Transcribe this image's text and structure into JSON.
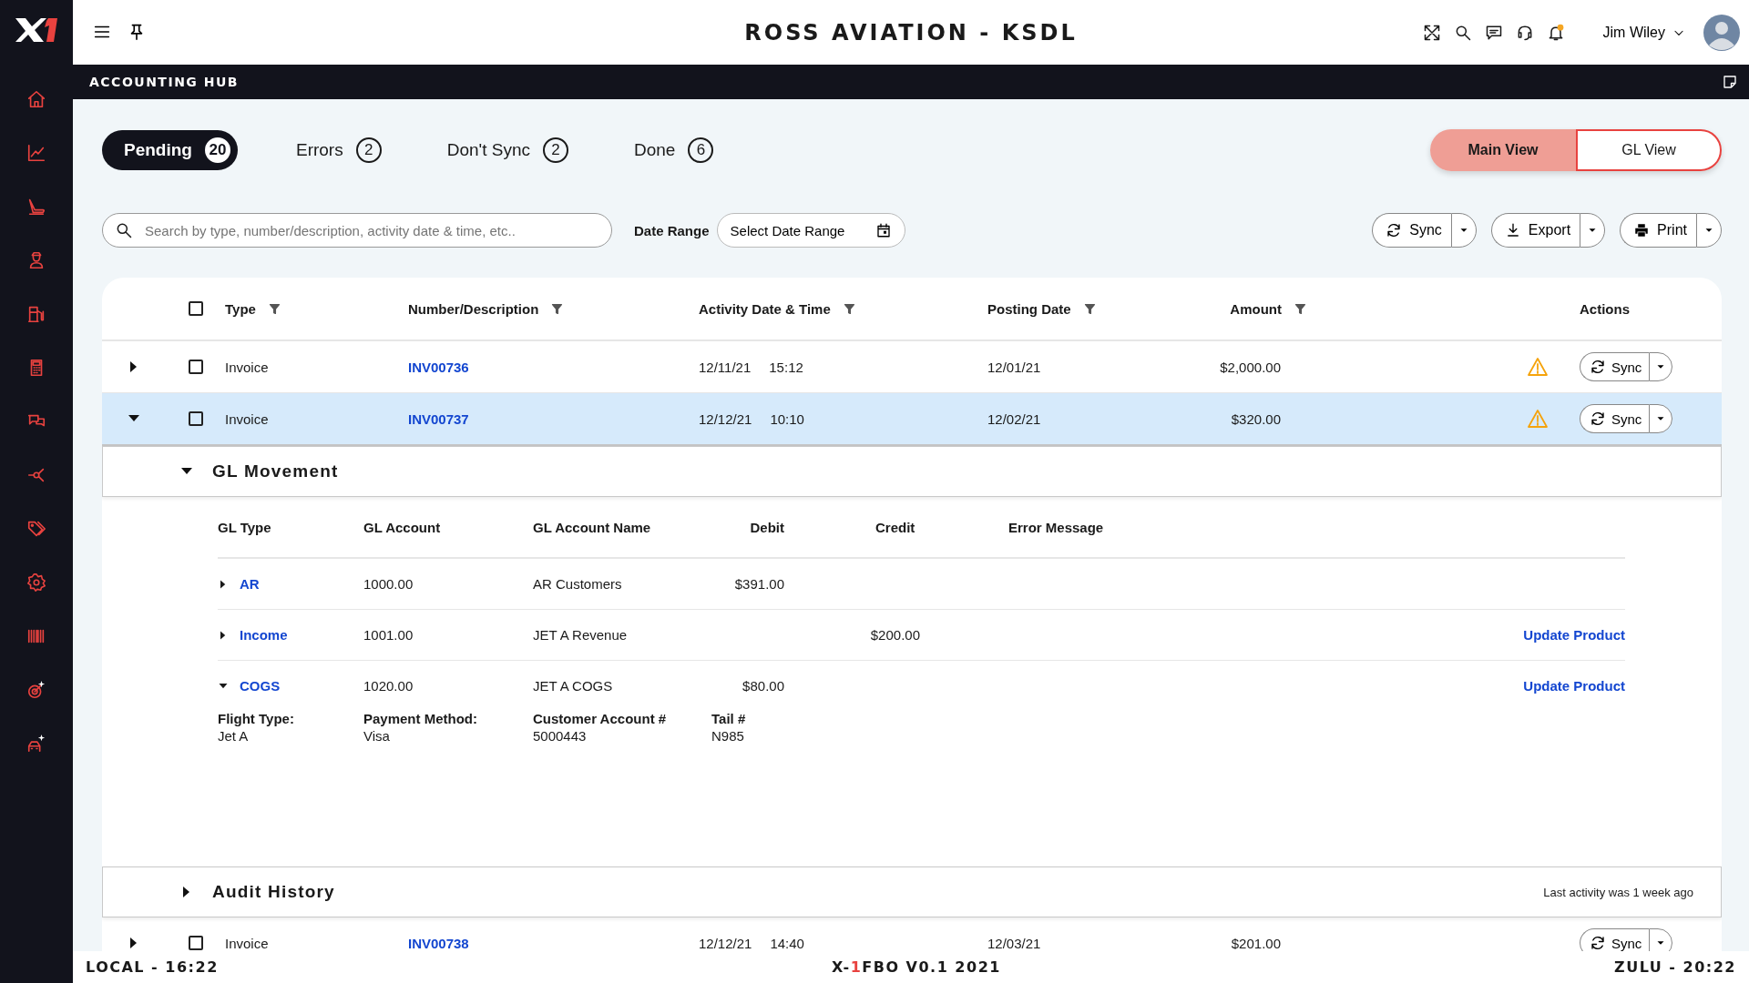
{
  "header": {
    "title": "ROSS AVIATION - KSDL",
    "user": "Jim Wiley",
    "unread_notifications": true
  },
  "hub_bar": {
    "title": "ACCOUNTING HUB"
  },
  "tabs": [
    {
      "label": "Pending",
      "count": "20",
      "selected": true
    },
    {
      "label": "Errors",
      "count": "2",
      "selected": false
    },
    {
      "label": "Don't Sync",
      "count": "2",
      "selected": false
    },
    {
      "label": "Done",
      "count": "6",
      "selected": false
    }
  ],
  "views": [
    {
      "label": "Main View",
      "selected": true
    },
    {
      "label": "GL View",
      "selected": false
    }
  ],
  "search": {
    "placeholder": "Search by type, number/description, activity date & time, etc.."
  },
  "date_range": {
    "label": "Date Range",
    "placeholder": "Select Date Range"
  },
  "toolbar_buttons": [
    {
      "label": "Sync",
      "kind": "sync"
    },
    {
      "label": "Export",
      "kind": "export"
    },
    {
      "label": "Print",
      "kind": "print"
    }
  ],
  "table": {
    "select_all_checked": false,
    "columns": [
      {
        "label": "Type",
        "kind": "filterable"
      },
      {
        "label": "Number/Description",
        "kind": "filterable"
      },
      {
        "label": "Activity Date & Time",
        "kind": "filterable"
      },
      {
        "label": "Posting Date",
        "kind": "filterable"
      },
      {
        "label": "Amount",
        "kind": "filterable"
      },
      {
        "label": "Actions",
        "kind": "plain"
      }
    ],
    "rows": [
      {
        "expanded": false,
        "checked": false,
        "selected": false,
        "type": "Invoice",
        "number": "INV00736",
        "date": "12/11/21",
        "time": "15:12",
        "posting_date": "12/01/21",
        "amount": "$2,000.00",
        "warning": true,
        "action": "Sync"
      },
      {
        "expanded": true,
        "checked": false,
        "selected": true,
        "type": "Invoice",
        "number": "INV00737",
        "date": "12/12/21",
        "time": "10:10",
        "posting_date": "12/02/21",
        "amount": "$320.00",
        "warning": true,
        "action": "Sync"
      },
      {
        "expanded": false,
        "checked": false,
        "selected": false,
        "type": "Invoice",
        "number": "INV00738",
        "date": "12/12/21",
        "time": "14:40",
        "posting_date": "12/03/21",
        "amount": "$201.00",
        "warning": false,
        "action": "Sync"
      }
    ]
  },
  "gl_movement": {
    "title": "GL Movement",
    "expanded": true,
    "columns": [
      "GL Type",
      "GL Account",
      "GL Account Name",
      "Debit",
      "Credit",
      "Error Message"
    ],
    "rows": [
      {
        "expanded": false,
        "type": "AR",
        "account": "1000.00",
        "name": "AR Customers",
        "debit": "$391.00"
      },
      {
        "expanded": false,
        "type": "Income",
        "account": "1001.00",
        "name": "JET A Revenue",
        "credit": "$200.00",
        "action": "Update Product"
      },
      {
        "expanded": true,
        "type": "COGS",
        "account": "1020.00",
        "name": "JET A COGS",
        "debit": "$80.00",
        "action": "Update Product",
        "details": [
          {
            "label": "Flight Type:",
            "value": "Jet A"
          },
          {
            "label": "Payment Method:",
            "value": "Visa"
          },
          {
            "label": "Customer Account #",
            "value": "5000443"
          },
          {
            "label": "Tail #",
            "value": "N985"
          }
        ]
      }
    ]
  },
  "audit_history": {
    "title": "Audit History",
    "expanded": false,
    "note": "Last activity was 1 week ago"
  },
  "status_bar": {
    "local": "LOCAL - 16:22",
    "version": {
      "prefix": "X-",
      "accent": "1",
      "rest": "FBO V0.1 2021"
    },
    "zulu": "ZULU - 20:22"
  }
}
